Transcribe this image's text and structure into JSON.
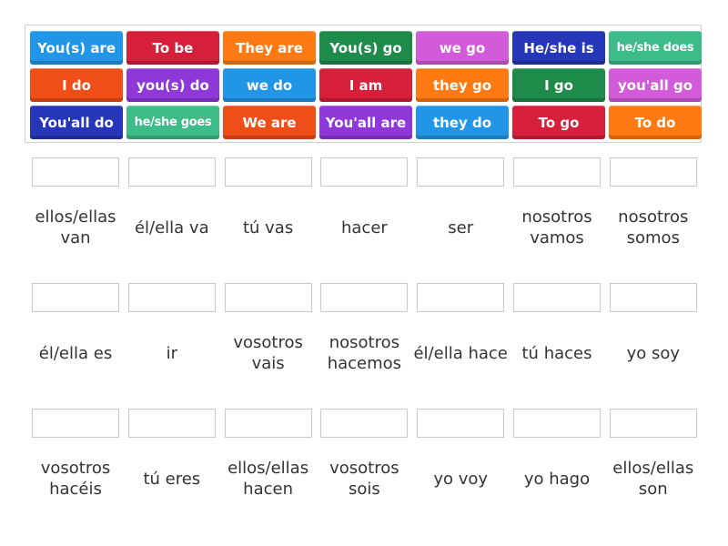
{
  "tile_bank": {
    "rows": [
      [
        {
          "text": "You(s) are",
          "color": "#2196e6"
        },
        {
          "text": "To be",
          "color": "#d61f3a"
        },
        {
          "text": "They are",
          "color": "#ff7a12"
        },
        {
          "text": "You(s) go",
          "color": "#1f8b4a"
        },
        {
          "text": "we go",
          "color": "#d15bd8"
        },
        {
          "text": "He/she is",
          "color": "#2537b8"
        },
        {
          "text": "he/she does",
          "color": "#3dbb88"
        }
      ],
      [
        {
          "text": "I do",
          "color": "#f04e18"
        },
        {
          "text": "you(s) do",
          "color": "#8f37d9"
        },
        {
          "text": "we do",
          "color": "#2196e6"
        },
        {
          "text": "I am",
          "color": "#d61f3a"
        },
        {
          "text": "they go",
          "color": "#ff7a12"
        },
        {
          "text": "I go",
          "color": "#1f8b4a"
        },
        {
          "text": "you'all go",
          "color": "#d15bd8"
        }
      ],
      [
        {
          "text": "You'all do",
          "color": "#2537b8"
        },
        {
          "text": "he/she goes",
          "color": "#3dbb88"
        },
        {
          "text": "We are",
          "color": "#f04e18"
        },
        {
          "text": "You'all are",
          "color": "#8f37d9"
        },
        {
          "text": "they do",
          "color": "#2196e6"
        },
        {
          "text": "To go",
          "color": "#d61f3a"
        },
        {
          "text": "To do",
          "color": "#ff7a12"
        }
      ]
    ]
  },
  "targets": {
    "rows": [
      [
        "ellos/ellas van",
        "él/ella va",
        "tú vas",
        "hacer",
        "ser",
        "nosotros vamos",
        "nosotros somos"
      ],
      [
        "él/ella es",
        "ir",
        "vosotros vais",
        "nosotros hacemos",
        "él/ella hace",
        "tú haces",
        "yo soy"
      ],
      [
        "vosotros hacéis",
        "tú eres",
        "ellos/ellas hacen",
        "vosotros sois",
        "yo voy",
        "yo hago",
        "ellos/ellas son"
      ]
    ]
  }
}
